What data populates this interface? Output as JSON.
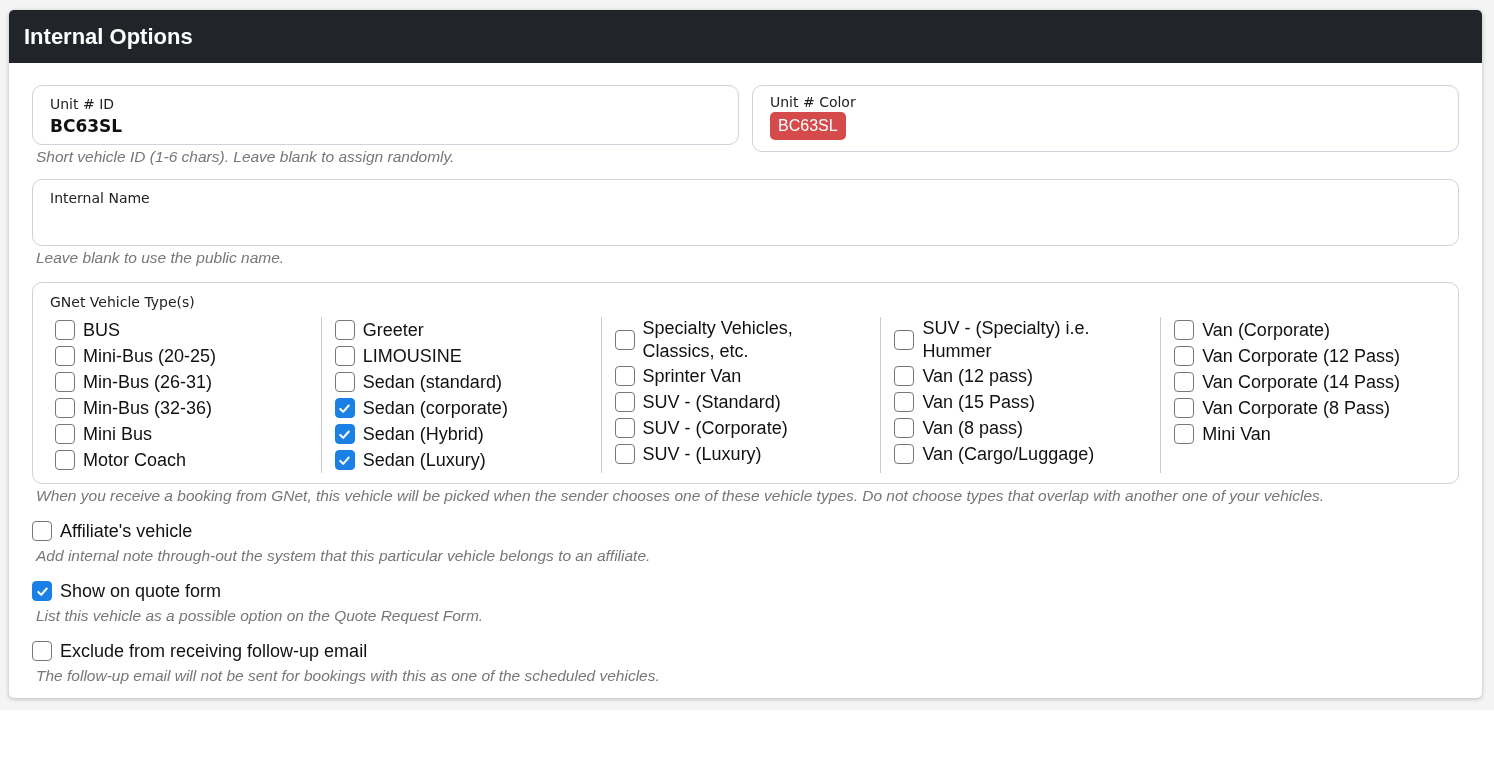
{
  "panel": {
    "title": "Internal Options"
  },
  "unit_id": {
    "label": "Unit # ID",
    "value": "BC63SL",
    "help": "Short vehicle ID (1-6 chars). Leave blank to assign randomly."
  },
  "unit_color": {
    "label": "Unit # Color",
    "badge": "BC63SL",
    "color": "#d54a4a"
  },
  "internal_name": {
    "label": "Internal Name",
    "help": "Leave blank to use the public name."
  },
  "vehicle_types": {
    "label": "GNet Vehicle Type(s)",
    "help": "When you receive a booking from GNet, this vehicle will be picked when the sender chooses one of these vehicle types. Do not choose types that overlap with another one of your vehicles.",
    "columns": [
      [
        {
          "label": "BUS",
          "checked": false
        },
        {
          "label": "Mini-Bus (20-25)",
          "checked": false
        },
        {
          "label": "Min-Bus (26-31)",
          "checked": false
        },
        {
          "label": "Min-Bus (32-36)",
          "checked": false
        },
        {
          "label": "Mini Bus",
          "checked": false
        },
        {
          "label": "Motor Coach",
          "checked": false
        }
      ],
      [
        {
          "label": "Greeter",
          "checked": false
        },
        {
          "label": "LIMOUSINE",
          "checked": false
        },
        {
          "label": "Sedan (standard)",
          "checked": false
        },
        {
          "label": "Sedan (corporate)",
          "checked": true
        },
        {
          "label": "Sedan (Hybrid)",
          "checked": true
        },
        {
          "label": "Sedan (Luxury)",
          "checked": true
        }
      ],
      [
        {
          "label": "Specialty Vehicles, Classics, etc.",
          "checked": false
        },
        {
          "label": "Sprinter Van",
          "checked": false
        },
        {
          "label": "SUV - (Standard)",
          "checked": false
        },
        {
          "label": "SUV - (Corporate)",
          "checked": false
        },
        {
          "label": "SUV - (Luxury)",
          "checked": false
        }
      ],
      [
        {
          "label": "SUV - (Specialty) i.e. Hummer",
          "checked": false
        },
        {
          "label": "Van (12 pass)",
          "checked": false
        },
        {
          "label": "Van (15 Pass)",
          "checked": false
        },
        {
          "label": "Van (8 pass)",
          "checked": false
        },
        {
          "label": "Van (Cargo/Luggage)",
          "checked": false
        }
      ],
      [
        {
          "label": "Van (Corporate)",
          "checked": false
        },
        {
          "label": "Van Corporate (12 Pass)",
          "checked": false
        },
        {
          "label": "Van Corporate (14 Pass)",
          "checked": false
        },
        {
          "label": "Van Corporate (8 Pass)",
          "checked": false
        },
        {
          "label": "Mini Van",
          "checked": false
        }
      ]
    ]
  },
  "options": [
    {
      "label": "Affiliate's vehicle",
      "checked": false,
      "help": "Add internal note through-out the system that this particular vehicle belongs to an affiliate."
    },
    {
      "label": "Show on quote form",
      "checked": true,
      "help": "List this vehicle as a possible option on the Quote Request Form."
    },
    {
      "label": "Exclude from receiving follow-up email",
      "checked": false,
      "help": "The follow-up email will not be sent for bookings with this as one of the scheduled vehicles."
    }
  ]
}
